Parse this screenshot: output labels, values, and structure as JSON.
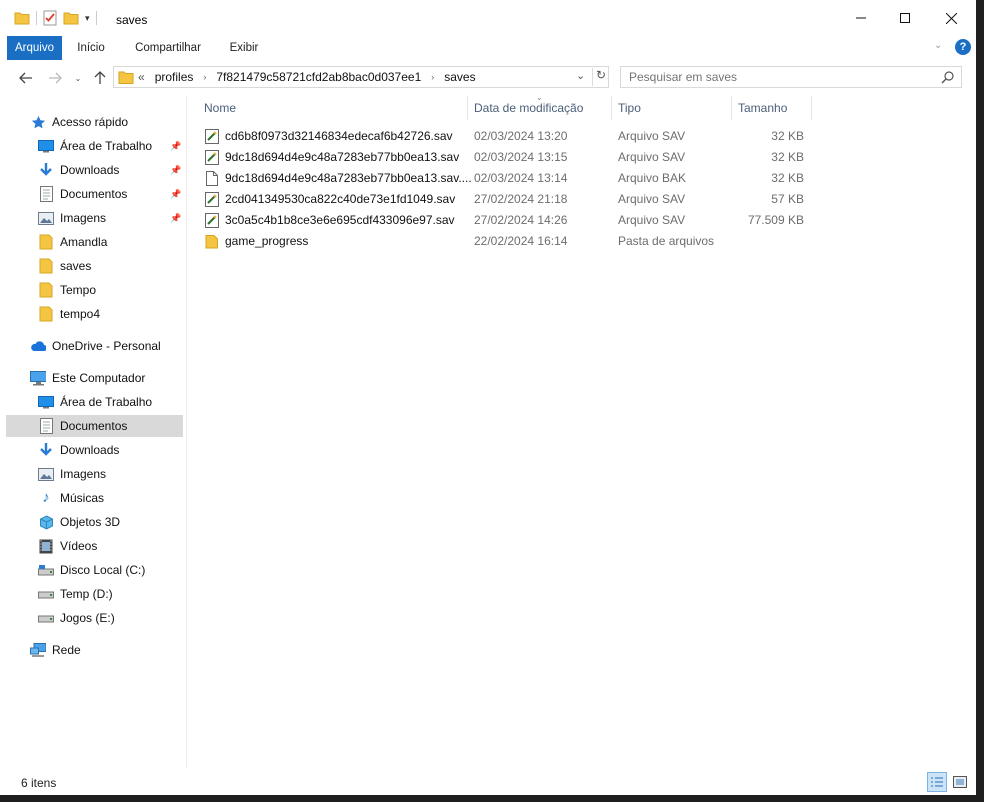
{
  "window": {
    "title": "saves",
    "controls": [
      "minimize-icon",
      "maximize-icon",
      "close-icon"
    ]
  },
  "ribbon": {
    "tabs": [
      "Arquivo",
      "Início",
      "Compartilhar",
      "Exibir"
    ]
  },
  "address_bar": {
    "overflow": "«",
    "crumbs": [
      "profiles",
      "7f821479c58721cfd2ab8bac0d037ee1",
      "saves"
    ]
  },
  "search": {
    "placeholder": "Pesquisar em saves"
  },
  "sidebar": {
    "quick_access": {
      "label": "Acesso rápido",
      "items": [
        {
          "label": "Área de Trabalho",
          "icon": "desktop-icon",
          "pinned": true
        },
        {
          "label": "Downloads",
          "icon": "download-icon",
          "pinned": true
        },
        {
          "label": "Documentos",
          "icon": "documents-icon",
          "pinned": true
        },
        {
          "label": "Imagens",
          "icon": "pictures-icon",
          "pinned": true
        },
        {
          "label": "Amandla",
          "icon": "folder-icon",
          "pinned": false
        },
        {
          "label": "saves",
          "icon": "folder-icon",
          "pinned": false
        },
        {
          "label": "Tempo",
          "icon": "folder-icon",
          "pinned": false
        },
        {
          "label": "tempo4",
          "icon": "folder-icon",
          "pinned": false
        }
      ]
    },
    "onedrive": {
      "label": "OneDrive - Personal"
    },
    "this_pc": {
      "label": "Este Computador",
      "items": [
        {
          "label": "Área de Trabalho",
          "icon": "desktop-icon"
        },
        {
          "label": "Documentos",
          "icon": "documents-icon",
          "selected": true
        },
        {
          "label": "Downloads",
          "icon": "download-icon"
        },
        {
          "label": "Imagens",
          "icon": "pictures-icon"
        },
        {
          "label": "Músicas",
          "icon": "music-icon"
        },
        {
          "label": "Objetos 3D",
          "icon": "3d-objects-icon"
        },
        {
          "label": "Vídeos",
          "icon": "videos-icon"
        },
        {
          "label": "Disco Local (C:)",
          "icon": "drive-c-icon"
        },
        {
          "label": "Temp (D:)",
          "icon": "drive-icon"
        },
        {
          "label": "Jogos (E:)",
          "icon": "drive-icon"
        }
      ]
    },
    "network": {
      "label": "Rede"
    }
  },
  "file_list": {
    "columns": [
      "Nome",
      "Data de modificação",
      "Tipo",
      "Tamanho"
    ],
    "rows": [
      {
        "name": "cd6b8f0973d32146834edecaf6b42726.sav",
        "date": "02/03/2024 13:20",
        "type": "Arquivo SAV",
        "size": "32 KB",
        "icon": "sav-file-icon"
      },
      {
        "name": "9dc18d694d4e9c48a7283eb77bb0ea13.sav",
        "date": "02/03/2024 13:15",
        "type": "Arquivo SAV",
        "size": "32 KB",
        "icon": "sav-file-icon"
      },
      {
        "name": "9dc18d694d4e9c48a7283eb77bb0ea13.sav....",
        "date": "02/03/2024 13:14",
        "type": "Arquivo BAK",
        "size": "32 KB",
        "icon": "blank-file-icon"
      },
      {
        "name": "2cd041349530ca822c40de73e1fd1049.sav",
        "date": "27/02/2024 21:18",
        "type": "Arquivo SAV",
        "size": "57 KB",
        "icon": "sav-file-icon"
      },
      {
        "name": "3c0a5c4b1b8ce3e6e695cdf433096e97.sav",
        "date": "27/02/2024 14:26",
        "type": "Arquivo SAV",
        "size": "77.509 KB",
        "icon": "sav-file-icon"
      },
      {
        "name": "game_progress",
        "date": "22/02/2024 16:14",
        "type": "Pasta de arquivos",
        "size": "",
        "icon": "folder-icon"
      }
    ]
  },
  "status_bar": {
    "item_count": "6 itens"
  },
  "colors": {
    "accent": "#1a6fc4",
    "folder": "#f4c542",
    "selection": "#d9d9d9",
    "header_text": "#4c607a"
  }
}
